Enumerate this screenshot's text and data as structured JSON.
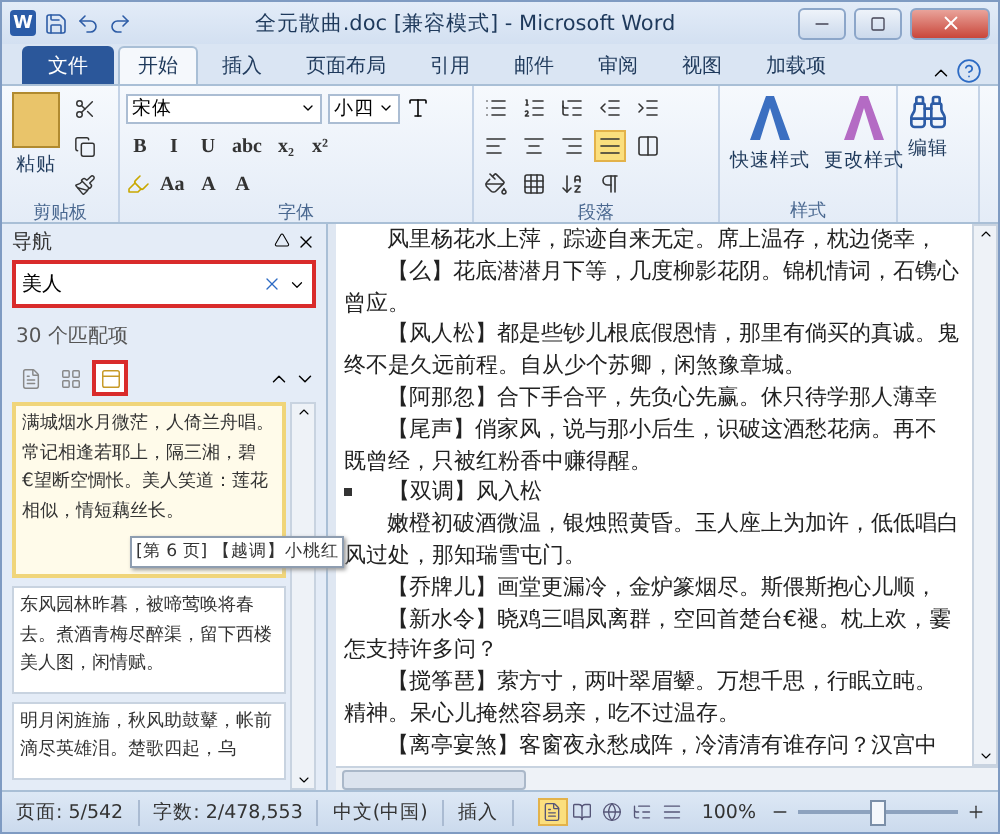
{
  "window": {
    "app_icon": "W",
    "title": "全元散曲.doc [兼容模式] - Microsoft Word"
  },
  "ribbon_tabs": [
    {
      "label": "文件",
      "kind": "file",
      "selected": false
    },
    {
      "label": "开始",
      "kind": "tab",
      "selected": true
    },
    {
      "label": "插入",
      "kind": "tab",
      "selected": false
    },
    {
      "label": "页面布局",
      "kind": "tab",
      "selected": false
    },
    {
      "label": "引用",
      "kind": "tab",
      "selected": false
    },
    {
      "label": "邮件",
      "kind": "tab",
      "selected": false
    },
    {
      "label": "审阅",
      "kind": "tab",
      "selected": false
    },
    {
      "label": "视图",
      "kind": "tab",
      "selected": false
    },
    {
      "label": "加载项",
      "kind": "tab",
      "selected": false
    }
  ],
  "ribbon": {
    "paste": "粘贴",
    "font_name": "宋体",
    "font_size": "小四",
    "format_buttons": [
      "B",
      "I",
      "U",
      "abc",
      "x₂",
      "x²"
    ],
    "case_button": "Aa",
    "grow_buttons": [
      "A",
      "A"
    ],
    "alignment": [
      {
        "selected": false
      },
      {
        "selected": false
      },
      {
        "selected": false
      },
      {
        "selected": true
      },
      {
        "selected": false
      }
    ],
    "style_buttons": [
      "快速样式",
      "更改样式"
    ],
    "editing": "编辑",
    "groups": [
      "剪贴板",
      "字体",
      "段落",
      "样式"
    ]
  },
  "navigation": {
    "title": "导航",
    "search_value": "美人",
    "match_count": "30 个匹配项",
    "views": [
      {
        "selected": false
      },
      {
        "selected": false
      },
      {
        "selected": true
      }
    ],
    "results": [
      {
        "text": "满城烟水月微茫，人倚兰舟唱。常记相逢若耶上，隔三湘，碧€望断空惆怅。美人笑道：莲花相似，情短藕丝长。",
        "selected": true
      },
      {
        "text": "东风园林昨暮，被啼莺唤将春去。煮酒青梅尽醉渠，留下西楼美人图，闲情赋。",
        "selected": false
      },
      {
        "text": "明月闲旌旆，秋风助鼓鼙，帐前滴尽英雄泪。楚歌四起，乌",
        "selected": false
      }
    ],
    "tooltip": "[第 6 页] 【越调】小桃红"
  },
  "document": {
    "lines": [
      {
        "kind": "indent",
        "text": "风里杨花水上萍，踪迹自来无定。席上温存，枕边侥幸，"
      },
      {
        "kind": "indent",
        "text": "【么】花底潜潜月下等，几度柳影花阴。锦机情词，石镌心"
      },
      {
        "kind": "plain",
        "text": "曾应。"
      },
      {
        "kind": "indent",
        "text": "【风人松】都是些钞儿根底假恩情，那里有倘买的真诚。鬼"
      },
      {
        "kind": "plain",
        "text": "终不是久远前程。自从少个苏卿，闲煞豫章城。"
      },
      {
        "kind": "indent",
        "text": "【阿那忽】合下手合平，先负心先赢。休只待学那人薄幸"
      },
      {
        "kind": "indent",
        "text": "【尾声】俏家风，说与那小后生，识破这酒愁花病。再不"
      },
      {
        "kind": "plain",
        "text": "既曾经，只被红粉香中赚得醒。"
      },
      {
        "kind": "bullet",
        "text": "【双调】风入松"
      },
      {
        "kind": "indent",
        "text": "嫩橙初破酒微温，银烛照黄昏。玉人座上为加许，低低唱白"
      },
      {
        "kind": "plain",
        "text": "风过处，那知瑞雪屯门。"
      },
      {
        "kind": "indent",
        "text": "【乔牌儿】画堂更漏冷，金炉篆烟尽。斯偎斯抱心儿顺，"
      },
      {
        "kind": "indent",
        "text": "【新水令】晓鸡三唱凤离群，空回首楚台€褪。枕上欢，霎"
      },
      {
        "kind": "plain",
        "text": "怎支持许多问？"
      },
      {
        "kind": "indent",
        "text": "【搅筝琶】萦方寸，两叶翠眉颦。万想千思，行眠立盹。"
      },
      {
        "kind": "plain",
        "text": "精神。呆心儿掩然容易亲，吃不过温存。"
      },
      {
        "kind": "indent",
        "text": "【离亭宴煞】客窗夜永愁成阵，冷清清有谁存问？汉宫中"
      }
    ]
  },
  "status_bar": {
    "items": [
      "页面: 5/542",
      "字数: 2/478,553"
    ],
    "language": "中文(中国)",
    "mode": "插入",
    "views": [
      {
        "selected": true
      },
      {
        "selected": false
      },
      {
        "selected": false
      },
      {
        "selected": false
      },
      {
        "selected": false
      }
    ],
    "zoom": "100%",
    "zoom_level": {
      "level": 0.5
    }
  }
}
